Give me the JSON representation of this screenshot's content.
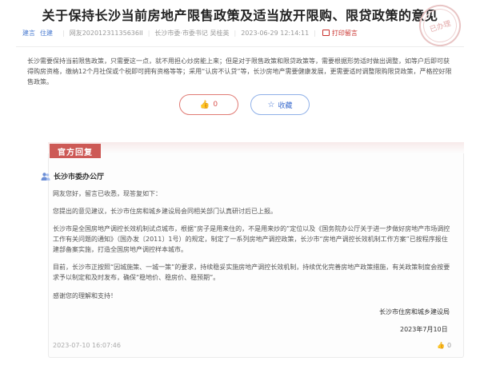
{
  "title": "关于保持长沙当前房地产限售政策及适当放开限购、限贷政策的意见",
  "meta": {
    "tags": [
      "建言",
      "住建"
    ],
    "user": "网友20201231135636II",
    "dept": "长沙市委·市委书记 吴桂英",
    "datetime": "2023-06-29 12:14:11",
    "print_label": "打印留言"
  },
  "stamp_text": "已办理",
  "content": "长沙需要保持当前限售政策，只需要这一点，就不用担心炒房能上来；但是对于限售政策和限贷政策等，需要根据形势适时做出调整，如等户后即可获得购房资格，缴纳12个月社保或个税即可拥有资格等等；采用“认房不认贷”等，长沙房地产需要健康发展，更需要适时调整限购限贷政策，严格控好限售政策。",
  "actions": {
    "like_count": "0",
    "favorite_label": "收藏"
  },
  "reply": {
    "label": "官方回复",
    "office": "长沙市委办公厅",
    "greeting": "网友您好，留言已收悉，现答复如下：",
    "p1": "您提出的意见建议，长沙市住房和城乡建设局会同相关部门认真研讨后已上报。",
    "p2": "长沙市是全国房地产调控长效机制试点城市，根据“房子是用来住的，不是用来炒的”定位以及《国务院办公厅关于进一步做好房地产市场调控工作有关问题的通知》（国办发〔2011〕1号）的规定，制定了一系列房地产调控政策，长沙市“房地产调控长效机制工作方案”已按程序报住建部备案实施，打造全国房地产调控样本城市。",
    "p3": "目前，长沙市正按照“因城施策、一城一策”的要求，持续稳妥实施房地产调控长效机制，持续优化完善房地产政策措施，有关政策制度会按要求予以制定和及时发布，确保“稳地价、稳房价、稳预期”。",
    "thanks": "感谢您的理解和支持！",
    "signature": "长沙市住房和城乡建设局",
    "sign_date": "2023年7月10日",
    "reply_datetime": "2023-07-10 16:07:46",
    "like_count": "0"
  },
  "colors": {
    "accent_red": "#cd5a56",
    "accent_blue": "#3f6fcf"
  }
}
